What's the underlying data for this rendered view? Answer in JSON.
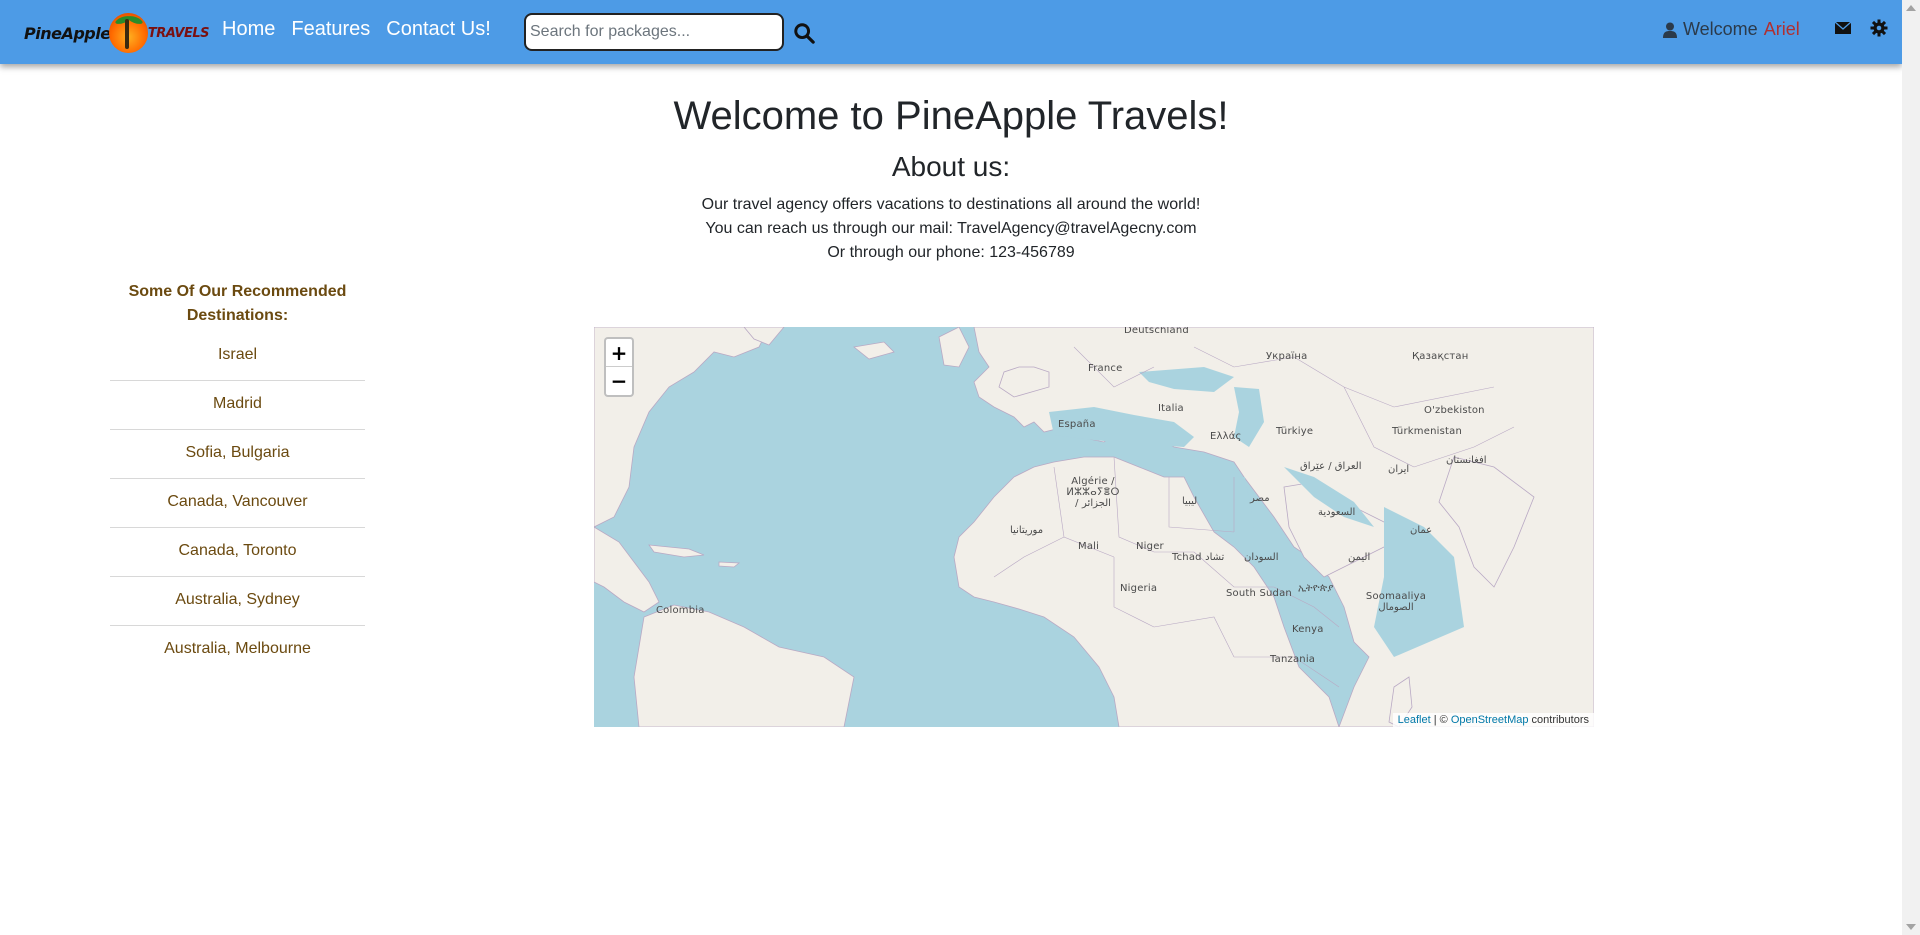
{
  "nav": {
    "brand_left": "PineApple",
    "brand_right": "TRAVELS",
    "links": [
      "Home",
      "Features",
      "Contact Us!"
    ],
    "search_placeholder": "Search for packages...",
    "welcome_text": "Welcome",
    "user_name": "Ariel"
  },
  "main": {
    "title": "Welcome to PineApple Travels!",
    "about_title": "About us:",
    "about_lines": [
      "Our travel agency offers vacations to destinations all around the world!",
      "You can reach us through our mail: TravelAgency@travelAgecny.com",
      "Or through our phone: 123-456789"
    ]
  },
  "sidebar": {
    "title": "Some Of Our Recommended Destinations:",
    "destinations": [
      "Israel",
      "Madrid",
      "Sofia, Bulgaria",
      "Canada, Vancouver",
      "Canada, Toronto",
      "Australia, Sydney",
      "Australia, Melbourne"
    ]
  },
  "map": {
    "zoom_in": "+",
    "zoom_out": "−",
    "attribution_leaflet": "Leaflet",
    "attribution_sep": " | © ",
    "attribution_osm": "OpenStreetMap",
    "attribution_tail": " contributors",
    "labels": [
      "Deutschland",
      "Україна",
      "Қазақстан",
      "France",
      "Italia",
      "O'zbekiston",
      "España",
      "Ελλάς",
      "Türkiye",
      "Türkmenistan",
      "العراق / عێراق",
      "ایران",
      "افغانستان",
      "Algérie / ⵍⵣⵣⴰⵢⴻⵔ / الجزائر",
      "ليبيا",
      "مصر",
      "السعودية",
      "موريتانيا",
      "عمان",
      "Mali",
      "Niger",
      "Tchad تشاد",
      "السودان",
      "اليمن",
      "Nigeria",
      "South Sudan",
      "ኢትዮጵያ",
      "Soomaaliya الصومال",
      "Colombia",
      "Kenya",
      "Tanzania"
    ]
  }
}
